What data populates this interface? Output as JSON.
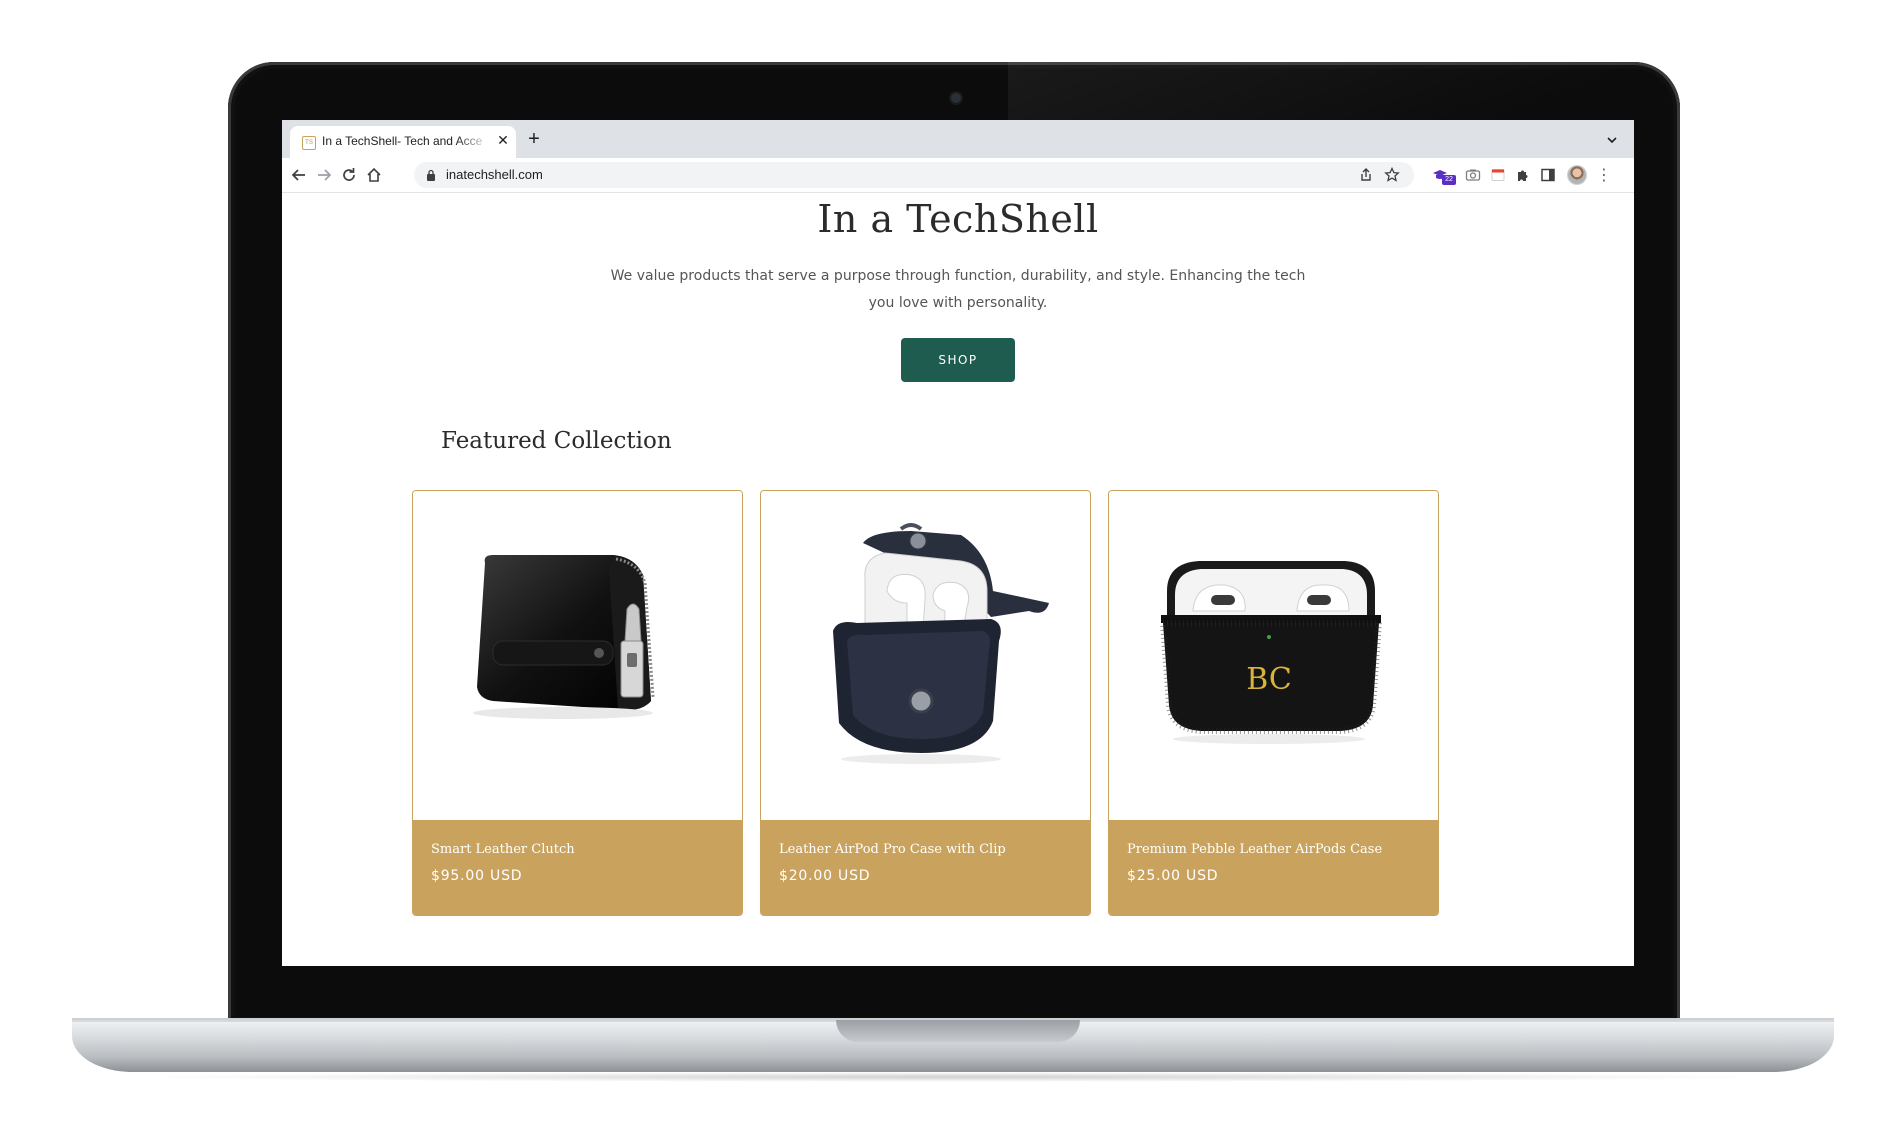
{
  "browser": {
    "tab_title": "In a TechShell- Tech and Acce",
    "tab_favicon_text": "TS",
    "url": "inatechshell.com",
    "extension_badge": "22"
  },
  "hero": {
    "title": "In a TechShell",
    "description": "We value products that serve a purpose through function, durability, and style. Enhancing the tech you love with personality.",
    "button_label": "SHOP"
  },
  "featured": {
    "heading": "Featured Collection",
    "products": [
      {
        "name": "Smart Leather Clutch",
        "price": "$95.00 USD",
        "image": "black-leather-clutch"
      },
      {
        "name": "Leather AirPod Pro Case with Clip",
        "price": "$20.00 USD",
        "image": "navy-leather-airpod-case"
      },
      {
        "name": "Premium Pebble Leather AirPods Case",
        "price": "$25.00 USD",
        "image": "black-pebble-airpods-case",
        "monogram": "BC"
      }
    ]
  },
  "colors": {
    "accent_gold": "#c9a35e",
    "button_green": "#1f5c50",
    "text_dark": "#2b2b2b"
  }
}
